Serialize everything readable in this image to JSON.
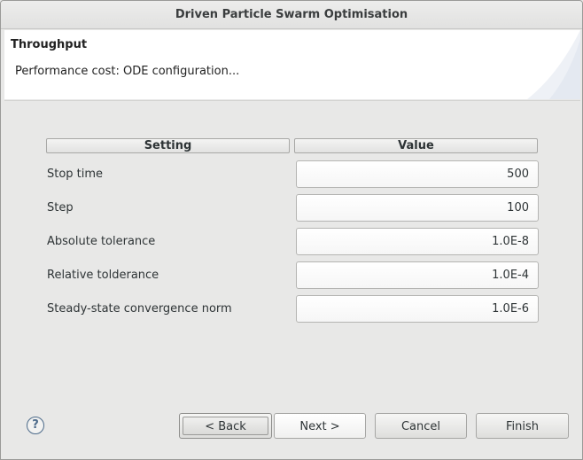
{
  "window": {
    "title": "Driven Particle Swarm Optimisation"
  },
  "banner": {
    "title": "Throughput",
    "message": "Performance cost: ODE configuration..."
  },
  "table": {
    "headers": {
      "setting": "Setting",
      "value": "Value"
    },
    "rows": [
      {
        "label": "Stop time",
        "value": "500"
      },
      {
        "label": "Step",
        "value": "100"
      },
      {
        "label": "Absolute tolerance",
        "value": "1.0E-8"
      },
      {
        "label": "Relative tolderance",
        "value": "1.0E-4"
      },
      {
        "label": "Steady-state convergence norm",
        "value": "1.0E-6"
      }
    ]
  },
  "buttons": {
    "help": "?",
    "back": "< Back",
    "next": "Next >",
    "cancel": "Cancel",
    "finish": "Finish"
  },
  "colors": {
    "background": "#e8e8e7",
    "banner": "#ffffff",
    "help_icon": "#4c6a8a"
  }
}
